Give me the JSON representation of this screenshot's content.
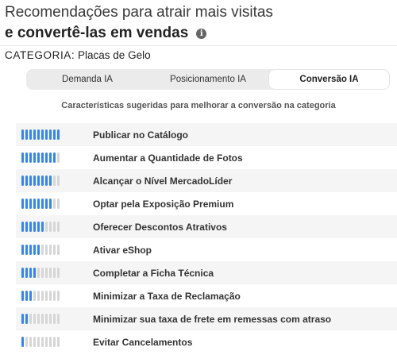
{
  "header": {
    "title_line1": "Recomendações para atrair mais visitas",
    "title_line2": "e convertê-las em vendas",
    "info_glyph": "i"
  },
  "category": {
    "label": "CATEGORIA:",
    "value": "Placas de Gelo"
  },
  "tabs": [
    {
      "label": "Demanda IA",
      "active": false
    },
    {
      "label": "Posicionamento IA",
      "active": false
    },
    {
      "label": "Conversão IA",
      "active": true
    }
  ],
  "subtitle": "Características sugeridas para melhorar a conversão na categoria",
  "colors": {
    "bar_active": "#3483fa",
    "bar_inactive": "#d6d6d6",
    "row_shade": "#f5f5f5"
  },
  "bar_total": 10,
  "items": [
    {
      "label": "Publicar no Catálogo",
      "level": 10
    },
    {
      "label": "Aumentar a Quantidade de Fotos",
      "level": 9
    },
    {
      "label": "Alcançar o Nível MercadoLíder",
      "level": 8
    },
    {
      "label": "Optar pela Exposição Premium",
      "level": 8
    },
    {
      "label": "Oferecer Descontos Atrativos",
      "level": 6
    },
    {
      "label": "Ativar eShop",
      "level": 5
    },
    {
      "label": "Completar a Ficha Técnica",
      "level": 4
    },
    {
      "label": "Minimizar a Taxa de Reclamação",
      "level": 3
    },
    {
      "label": "Minimizar sua taxa de frete em remessas com atraso",
      "level": 2
    },
    {
      "label": "Evitar Cancelamentos",
      "level": 1
    }
  ]
}
